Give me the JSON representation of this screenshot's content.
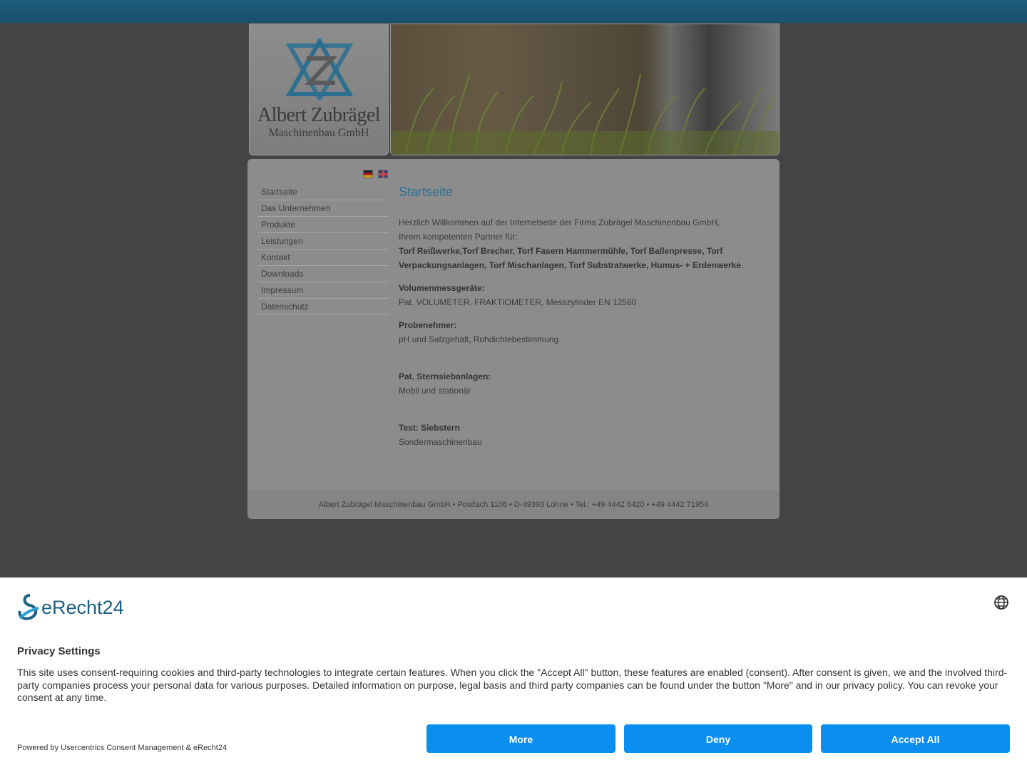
{
  "header": {
    "company_name": "Albert Zubrägel",
    "company_sub": "Maschinenbau GmbH"
  },
  "languages": [
    "Deutsch",
    "English"
  ],
  "nav": {
    "items": [
      {
        "label": "Startseite"
      },
      {
        "label": "Das Unternehmen"
      },
      {
        "label": "Produkte"
      },
      {
        "label": "Leistungen"
      },
      {
        "label": "Kontakt"
      },
      {
        "label": "Downloads"
      },
      {
        "label": "Impressum"
      },
      {
        "label": "Datenschutz"
      }
    ]
  },
  "content": {
    "title": "Startseite",
    "intro_line1": "Herzlich Willkommen auf der Internetseite der Firma Zubrägel Maschinenbau GmbH,",
    "intro_line2": "Ihrem kompetenten Partner für:",
    "products": "Torf Reißwerke,Torf Brecher, Torf Fasern Hammermühle, Torf Ballenpresse, Torf Verpackungsanlagen, Torf Mischanlagen, Torf Substratwerke, Humus- + Erdenwerke",
    "products_end": ".",
    "sections": [
      {
        "title": "Volumenmessgeräte:",
        "text": "Pat. VOLUMETER, FRAKTIOMETER, Messzylinder EN 12580"
      },
      {
        "title": "Probenehmer:",
        "text": "pH und Salzgehalt, Rohdichtebestimmung"
      },
      {
        "title": "Pat. Sternsiebanlagen:",
        "text": "Mobil und stationär"
      },
      {
        "title": "Test: Siebstern",
        "text": "Sondermaschinenbau"
      }
    ]
  },
  "footer": {
    "text": "Albert Zubrägel Maschinenbau GmbH • Postfach 1106 • D-49393 Lohne • Tel.: +49 4442 6420 • +49 4442 71954"
  },
  "consent": {
    "brand": "eRecht24",
    "title": "Privacy Settings",
    "text": "This site uses consent-requiring cookies and third-party technologies to integrate certain features. When you click the \"Accept All\" button, these features are enabled (consent). After consent is given, we and the involved third-party companies process your personal data for various purposes. Detailed information on purpose, legal basis and third party companies can be found under the button \"More\" and in our privacy policy. You can revoke your consent at any time.",
    "powered": "Powered by Usercentrics Consent Management & eRecht24",
    "buttons": {
      "more": "More",
      "deny": "Deny",
      "accept": "Accept All"
    },
    "accent_color": "#0a8ef0"
  }
}
